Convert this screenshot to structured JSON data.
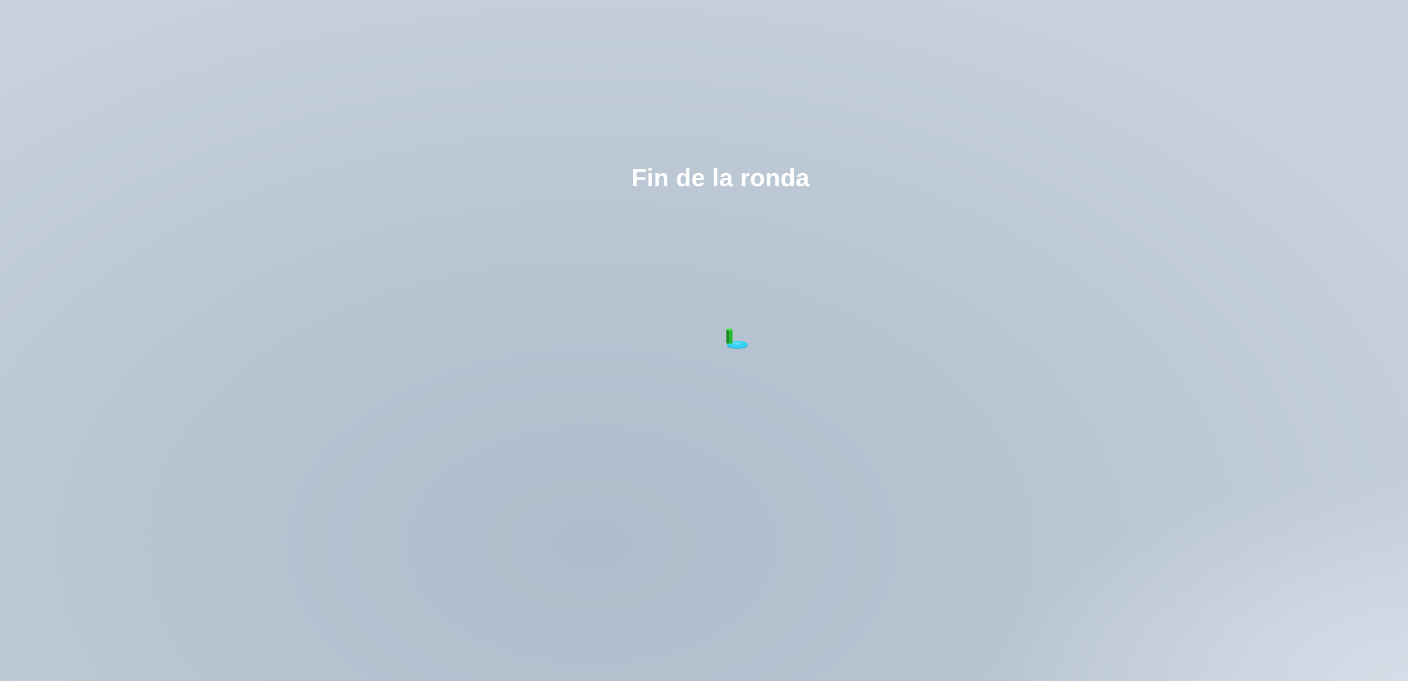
{
  "hud": {
    "round_message": "Fin de la ronda"
  },
  "scene": {
    "background_color": "#b6c2d0",
    "player": {
      "body_color": "#2ed13b",
      "base_color": "#2fd0f2",
      "icon": "player-figure-icon"
    }
  }
}
